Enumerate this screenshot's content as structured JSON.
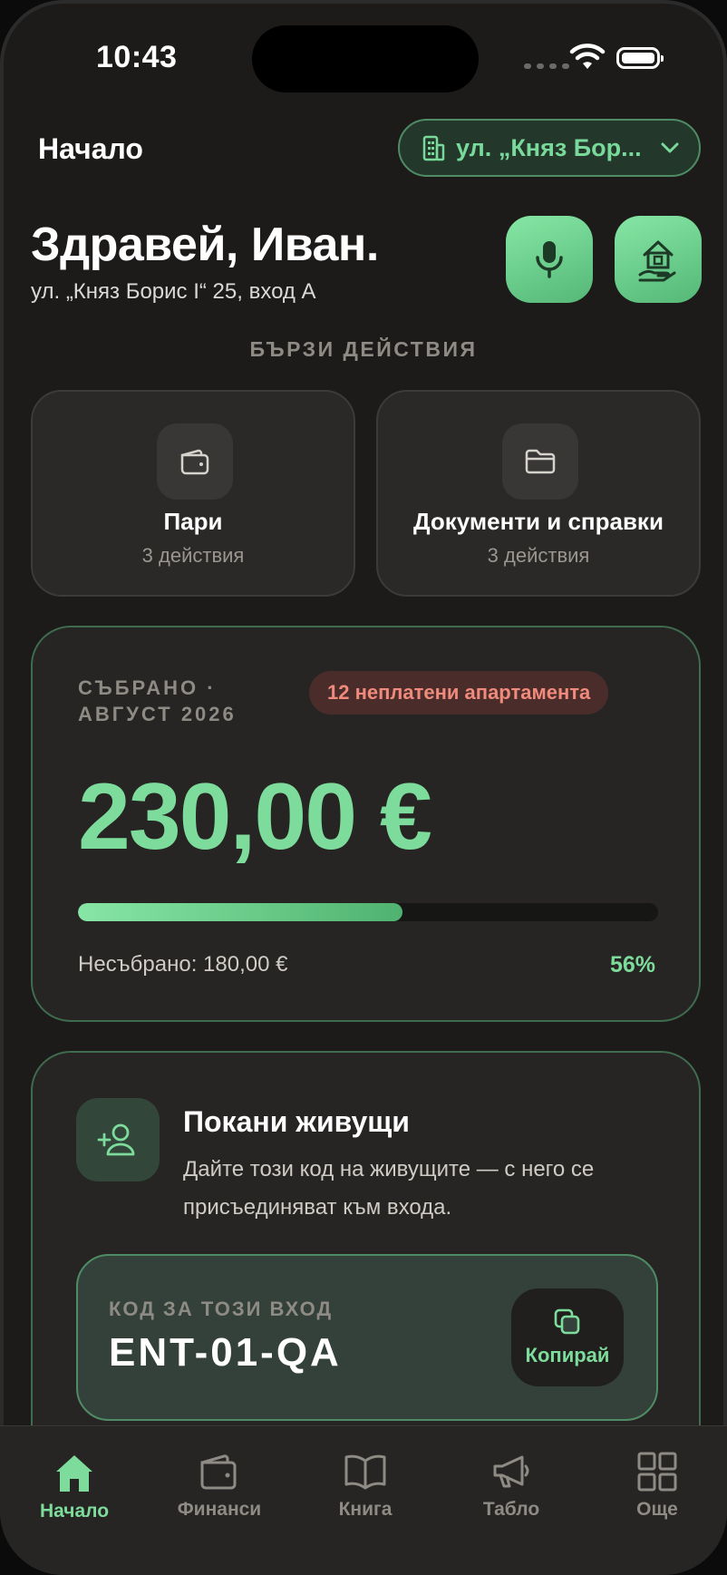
{
  "status_bar": {
    "time": "10:43"
  },
  "header": {
    "title": "Начало",
    "address_select": "ул. „Княз Бор..."
  },
  "greeting": {
    "title": "Здравей, Иван.",
    "address": "ул. „Княз Борис I“ 25, вход А"
  },
  "quick_actions": {
    "title": "БЪРЗИ ДЕЙСТВИЯ",
    "items": [
      {
        "title": "Пари",
        "subtitle": "3 действия",
        "icon": "wallet-icon"
      },
      {
        "title": "Документи и справки",
        "subtitle": "3 действия",
        "icon": "folder-icon"
      }
    ]
  },
  "collected": {
    "label": "СЪБРАНО · АВГУСТ 2026",
    "unpaid_badge": "12 неплатени апартамента",
    "amount": "230,00 €",
    "uncollected": "Несъбрано: 180,00 €",
    "percent_label": "56%",
    "progress": 0.56
  },
  "invite": {
    "title": "Покани живущи",
    "description": "Дайте този код на живущите — с него се присъединяват към входа.",
    "code_label": "КОД ЗА ТОЗИ ВХОД",
    "code": "ENT-01-QA",
    "copy_label": "Копирай"
  },
  "tabbar": {
    "items": [
      {
        "label": "Начало",
        "icon": "home-icon",
        "active": true
      },
      {
        "label": "Финанси",
        "icon": "wallet-icon",
        "active": false
      },
      {
        "label": "Книга",
        "icon": "book-icon",
        "active": false
      },
      {
        "label": "Табло",
        "icon": "megaphone-icon",
        "active": false
      },
      {
        "label": "Още",
        "icon": "grid-icon",
        "active": false
      }
    ]
  },
  "colors": {
    "accent": "#7ddb9b",
    "background": "#1c1b19",
    "card": "#262523",
    "danger": "#f08a7c"
  }
}
